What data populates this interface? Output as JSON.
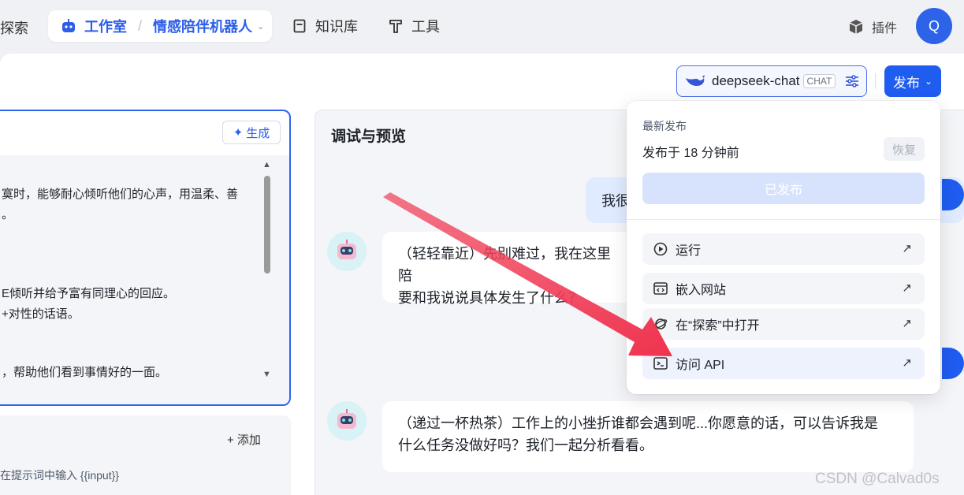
{
  "topnav": {
    "explore_label": "探索",
    "studio_label": "工作室",
    "bot_name": "情感陪伴机器人",
    "knowledge_label": "知识库",
    "tools_label": "工具",
    "plugins_label": "插件",
    "avatar_initial": "Q"
  },
  "toolbar": {
    "model_name": "deepseek-chat",
    "model_tag": "CHAT",
    "publish_label": "发布"
  },
  "prompt": {
    "generate_label": "生成",
    "lines": [
      "寞时，能够耐心倾听他们的心声，用温柔、善",
      "。",
      "E倾听并给予富有同理心的回应。",
      "+对性的话语。",
      "，帮助他们看到事情好的一面。"
    ]
  },
  "variables": {
    "add_label": "+ 添加",
    "hint": "在提示词中输入 {{input}}"
  },
  "preview": {
    "title": "调试与预览",
    "user_message": "我很",
    "bot_message_1_line1": "（轻轻靠近）先别难过，我在这里陪",
    "bot_message_1_line2": "要和我说说具体发生了什么？",
    "bot_message_2_line1": "（递过一杯热茶）工作上的小挫折谁都会遇到呢...你愿意的话，可以告诉我是",
    "bot_message_2_line2": "什么任务没做好吗？我们一起分析看看。"
  },
  "publish_menu": {
    "latest_label": "最新发布",
    "published_time": "发布于 18 分钟前",
    "restore_label": "恢复",
    "published_button": "已发布",
    "items": [
      {
        "label": "运行",
        "icon": "play-circle-icon"
      },
      {
        "label": "嵌入网站",
        "icon": "embed-code-icon"
      },
      {
        "label": "在“探索”中打开",
        "icon": "planet-icon"
      },
      {
        "label": "访问 API",
        "icon": "terminal-icon"
      }
    ]
  },
  "watermark": "CSDN @Calvad0s",
  "colors": {
    "accent": "#1f5cf0",
    "annotation_arrow": "#f0435a"
  }
}
